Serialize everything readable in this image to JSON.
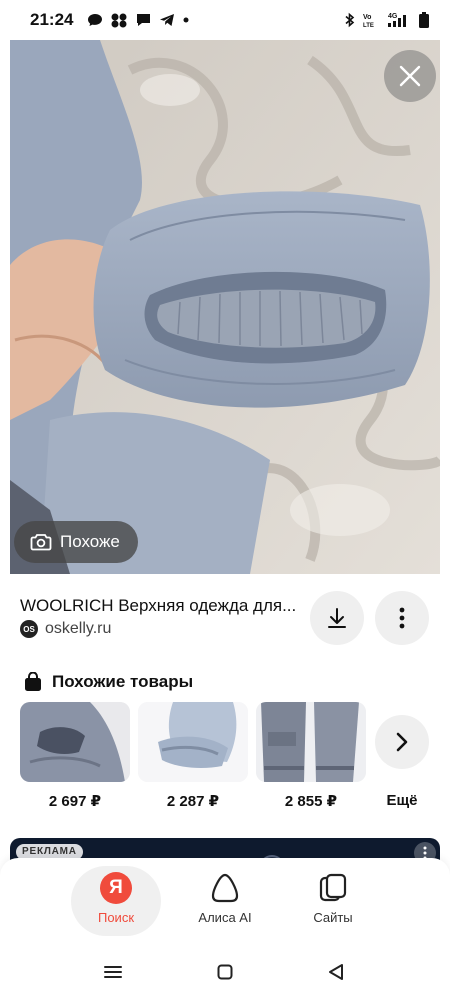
{
  "status_bar": {
    "time": "21:24",
    "left_icons": [
      "chat-bubble-icon",
      "apps-cluster-icon",
      "message-icon",
      "telegram-icon",
      "dot-icon"
    ],
    "right_icons": [
      "bluetooth-icon",
      "volte-icon",
      "signal-4g-icon",
      "battery-icon"
    ],
    "network_label": "4G",
    "volte_label": "Vo LTE"
  },
  "image_viewer": {
    "close_icon": "close-icon",
    "similar_button_label": "Похоже",
    "similar_icon": "camera-search-icon"
  },
  "result": {
    "title": "WOOLRICH Верхняя одежда для...",
    "source_logo_text": "OS",
    "source": "oskelly.ru",
    "download_icon": "download-icon",
    "more_icon": "more-vertical-icon"
  },
  "similar_products": {
    "heading": "Похожие товары",
    "heading_icon": "shopping-bag-icon",
    "items": [
      {
        "price": "2 697 ₽"
      },
      {
        "price": "2 287 ₽"
      },
      {
        "price": "2 855 ₽"
      }
    ],
    "more_label": "Ещё",
    "more_icon": "chevron-right-icon"
  },
  "ad": {
    "label": "РЕКЛАМА"
  },
  "bottom_nav": {
    "items": [
      {
        "label": "Поиск",
        "icon": "yandex-logo-icon",
        "logo_text": "Я",
        "active": true
      },
      {
        "label": "Алиса AI",
        "icon": "alice-icon",
        "active": false
      },
      {
        "label": "Сайты",
        "icon": "sites-icon",
        "active": false
      }
    ]
  },
  "colors": {
    "accent": "#f04b3c",
    "ad_background": "#0e1a2e"
  }
}
